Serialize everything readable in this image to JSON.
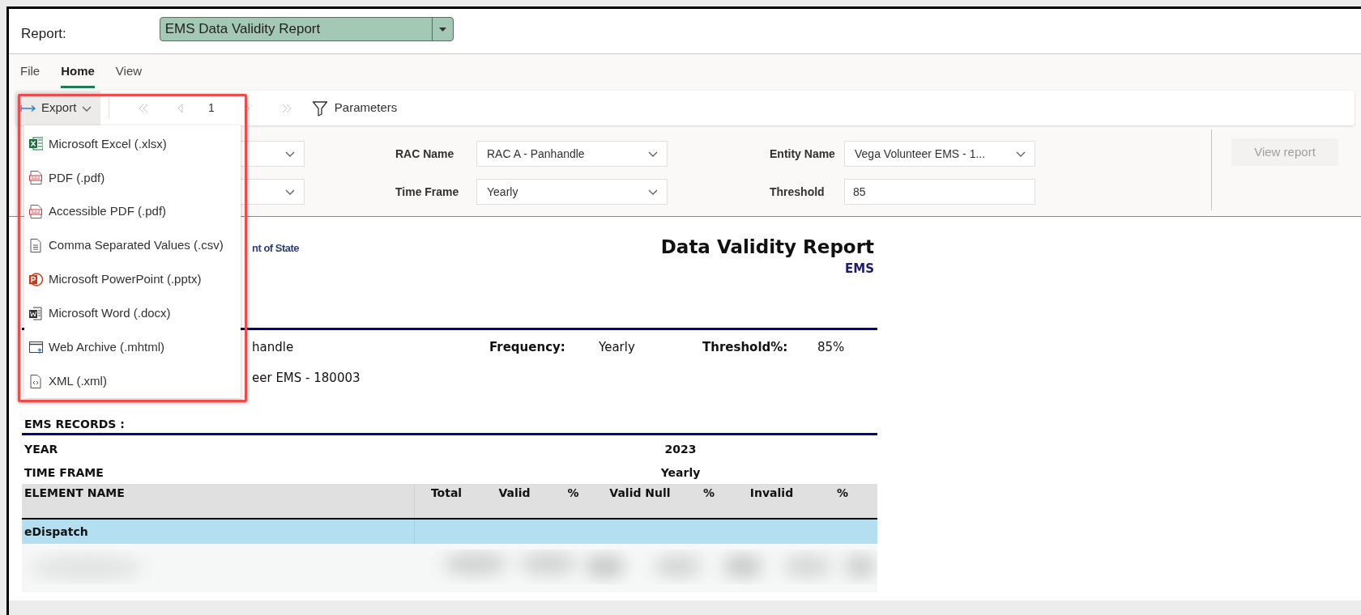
{
  "report_selector": {
    "label": "Report:",
    "value": "EMS Data Validity Report"
  },
  "menu_tabs": [
    {
      "label": "File",
      "selected": false
    },
    {
      "label": "Home",
      "selected": true
    },
    {
      "label": "View",
      "selected": false
    }
  ],
  "toolbar": {
    "export": "Export",
    "page": "1",
    "parameters": "Parameters"
  },
  "export_menu": [
    {
      "label": "Microsoft Excel (.xlsx)",
      "kind": "excel"
    },
    {
      "label": "PDF (.pdf)",
      "kind": "pdf"
    },
    {
      "label": "Accessible PDF (.pdf)",
      "kind": "pdf"
    },
    {
      "label": "Comma Separated Values (.csv)",
      "kind": "csv"
    },
    {
      "label": "Microsoft PowerPoint (.pptx)",
      "kind": "powerpoint"
    },
    {
      "label": "Microsoft Word (.docx)",
      "kind": "word"
    },
    {
      "label": "Web Archive (.mhtml)",
      "kind": "web"
    },
    {
      "label": "XML (.xml)",
      "kind": "xml"
    }
  ],
  "parameters": [
    {
      "kind": "dropdown"
    },
    {
      "label": "RAC Name",
      "value": "RAC A - Panhandle",
      "kind": "dropdown"
    },
    {
      "label": "Entity Name",
      "value": "Vega Volunteer EMS - 1...",
      "kind": "dropdown"
    },
    {
      "kind": "dropdown"
    },
    {
      "label": "Time Frame",
      "value": "Yearly",
      "kind": "dropdown"
    },
    {
      "label": "Threshold",
      "value": "85",
      "kind": "text"
    }
  ],
  "view_report": {
    "label": "View report",
    "disabled": true
  },
  "report": {
    "logo_text": "nt of State",
    "title": "Data Validity Report",
    "subtitle": "EMS",
    "info_rows": [
      [
        {
          "text": "handle",
          "kind": "value"
        },
        {
          "text": "Frequency:",
          "kind": "label"
        },
        {
          "text": "Yearly",
          "kind": "value"
        },
        {
          "text": "Threshold%:",
          "kind": "label"
        },
        {
          "text": "85%",
          "kind": "value"
        }
      ],
      [
        {
          "text": "eer EMS - 180003",
          "kind": "value"
        }
      ]
    ],
    "section_title": "EMS RECORDS :",
    "year_label": "YEAR",
    "year": "2023",
    "time_frame_label": "TIME FRAME",
    "time_frame": "Yearly",
    "columns": [
      "ELEMENT NAME",
      "Total",
      "Valid",
      "%",
      "Valid Null",
      "%",
      "Invalid",
      "%"
    ],
    "group_row": "eDispatch"
  }
}
